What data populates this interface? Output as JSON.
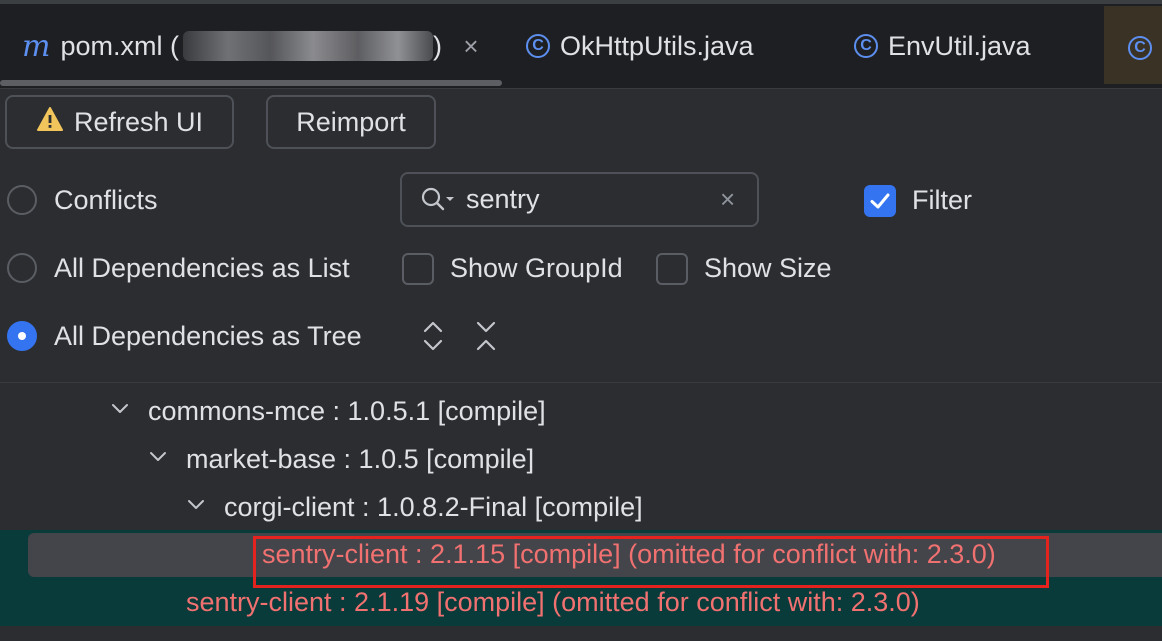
{
  "tabs": [
    {
      "label": "pom.xml (",
      "tail": ")",
      "icon": "maven-m-icon",
      "glyph": "m"
    },
    {
      "label": "OkHttpUtils.java",
      "icon": "java-class-icon",
      "glyph": "C"
    },
    {
      "label": "EnvUtil.java",
      "icon": "java-class-icon",
      "glyph": "C"
    },
    {
      "label": "",
      "icon": "java-class-icon",
      "glyph": "C"
    }
  ],
  "tab_close_glyph": "×",
  "toolbar": {
    "refresh_label": "Refresh UI",
    "refresh_icon": "warning-icon",
    "reimport_label": "Reimport"
  },
  "modes": {
    "conflicts_label": "Conflicts",
    "list_label": "All Dependencies as List",
    "tree_label": "All Dependencies as Tree",
    "selected": "tree"
  },
  "search": {
    "value": "sentry",
    "placeholder": "",
    "clear_glyph": "×"
  },
  "options": {
    "filter_label": "Filter",
    "filter_checked": true,
    "show_groupid_label": "Show GroupId",
    "show_groupid_checked": false,
    "show_size_label": "Show Size",
    "show_size_checked": false
  },
  "tree_rows": [
    {
      "text": "commons-mce : 1.0.5.1 [compile]",
      "level": 1,
      "expanded": true,
      "status": "normal"
    },
    {
      "text": "market-base : 1.0.5 [compile]",
      "level": 2,
      "expanded": true,
      "status": "normal"
    },
    {
      "text": "corgi-client : 1.0.8.2-Final [compile]",
      "level": 3,
      "expanded": true,
      "status": "normal"
    },
    {
      "text": "sentry-client : 2.1.15 [compile] (omitted for conflict with: 2.3.0)",
      "level": 4,
      "status": "conflict",
      "selected": true
    },
    {
      "text": "sentry-client : 2.1.19 [compile] (omitted for conflict with: 2.3.0)",
      "level": 2,
      "status": "conflict"
    }
  ],
  "colors": {
    "accent": "#3574f0",
    "conflict_text": "#f17171",
    "conflict_row_bg": "#083b3a",
    "highlight_box": "#e5231e",
    "background": "#2b2d30"
  }
}
